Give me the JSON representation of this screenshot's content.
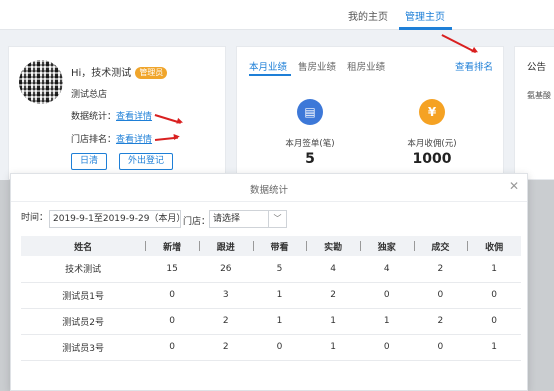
{
  "topnav": {
    "home": "我的主页",
    "manage": "管理主页"
  },
  "profile": {
    "greeting": "Hi，技术测试",
    "role": "管理员",
    "store": "测试总店",
    "data_stats_label": "数据统计：",
    "data_stats_link": "查看详情",
    "store_rank_label": "门店排名：",
    "store_rank_link": "查看详情",
    "daily_button": "日清",
    "outing_button": "外出登记"
  },
  "performance": {
    "tabs": [
      "本月业绩",
      "售房业绩",
      "租房业绩"
    ],
    "active_tab": 0,
    "rank_link": "查看排名",
    "stats": [
      {
        "label": "本月签单(笔)",
        "value": "5",
        "icon": "document-icon",
        "color": "#3d78d8"
      },
      {
        "label": "本月收佣(元)",
        "value": "1000",
        "icon": "yen-icon",
        "color": "#f5a223"
      }
    ]
  },
  "notice": {
    "title": "公告",
    "text": "氨基酸"
  },
  "accent": "#1e7fd7",
  "modal": {
    "title": "数据统计",
    "time_label": "时间：",
    "time_value": "2019-9-1至2019-9-29（本月）",
    "store_label": "门店：",
    "store_placeholder": "请选择",
    "columns": [
      "姓名",
      "新增",
      "跟进",
      "带看",
      "实勘",
      "独家",
      "成交",
      "收佣"
    ],
    "rows": [
      [
        "技术测试",
        "15",
        "26",
        "5",
        "4",
        "4",
        "2",
        "1"
      ],
      [
        "测试员1号",
        "0",
        "3",
        "1",
        "2",
        "0",
        "0",
        "0"
      ],
      [
        "测试员2号",
        "0",
        "2",
        "1",
        "1",
        "1",
        "2",
        "0"
      ],
      [
        "测试员3号",
        "0",
        "2",
        "0",
        "1",
        "0",
        "0",
        "1"
      ]
    ]
  }
}
